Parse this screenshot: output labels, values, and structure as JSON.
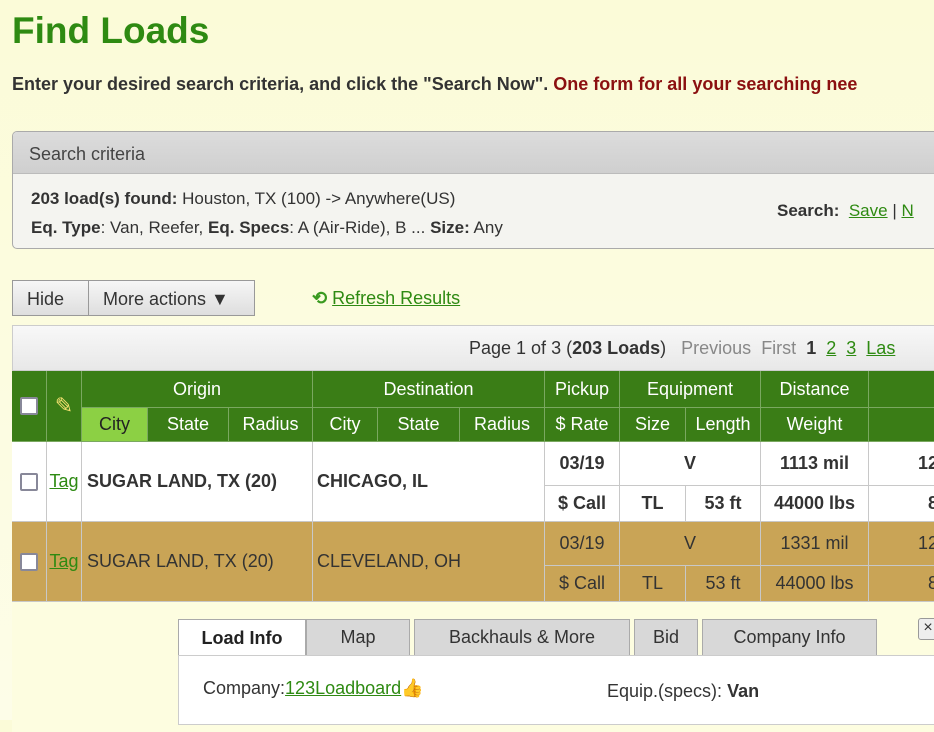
{
  "title": "Find Loads",
  "intro": {
    "text": "Enter your desired search criteria, and click the \"Search Now\".",
    "highlight": "One form for all your searching nee"
  },
  "criteria": {
    "header": "Search criteria",
    "found_label": "203 load(s) found:",
    "found_value": "Houston, TX (100) -> Anywhere(US)",
    "eq_type_label": "Eq. Type",
    "eq_type_value": ":  Van, Reefer,",
    "eq_specs_label": "Eq. Specs",
    "eq_specs_value": ":  A  (Air-Ride), B  ...",
    "size_label": "Size:",
    "size_value": " Any",
    "search_label": "Search:",
    "save_link": "Save",
    "sep": "|",
    "next_link": "N"
  },
  "actions": {
    "hide": "Hide",
    "more": "More actions ▼",
    "refresh": "Refresh Results"
  },
  "pager": {
    "page_text": "Page 1 of 3 (",
    "loads": "203 Loads",
    "close": ")",
    "previous": "Previous",
    "first": "First",
    "current": "1",
    "p2": "2",
    "p3": "3",
    "last": "Las"
  },
  "table": {
    "groups": {
      "origin": "Origin",
      "destination": "Destination",
      "pickup": "Pickup",
      "equipment": "Equipment",
      "distance": "Distance"
    },
    "sub": {
      "city": "City",
      "state": "State",
      "radius": "Radius",
      "dcity": "City",
      "dstate": "State",
      "dradius": "Radius",
      "rate": "$ Rate",
      "size": "Size",
      "length": "Length",
      "weight": "Weight"
    },
    "rows": [
      {
        "tag": "Tag",
        "origin": "SUGAR LAND, TX (20)",
        "dest": "CHICAGO, IL",
        "pickup": "03/19",
        "equip": "V",
        "distance": "1113 mil",
        "rate": "$ Call",
        "size": "TL",
        "length": "53 ft",
        "weight": "44000 lbs",
        "extra1": "12",
        "extra2": "8"
      },
      {
        "tag": "Tag",
        "origin": "SUGAR LAND, TX (20)",
        "dest": "CLEVELAND, OH",
        "pickup": "03/19",
        "equip": "V",
        "distance": "1331 mil",
        "rate": "$ Call",
        "size": "TL",
        "length": "53 ft",
        "weight": "44000 lbs",
        "extra1": "12",
        "extra2": "8"
      }
    ]
  },
  "detail": {
    "tabs": [
      "Load Info",
      "Map",
      "Backhauls & More",
      "Bid",
      "Company Info"
    ],
    "close": "×",
    "company_label": "Company:",
    "company_link": "123Loadboard",
    "equip_label": "Equip.(specs):",
    "equip_value": "Van"
  },
  "colors": {
    "header_green": "#3a7d16",
    "selected_row": "#c9a456",
    "title_green": "#2e8a12"
  }
}
